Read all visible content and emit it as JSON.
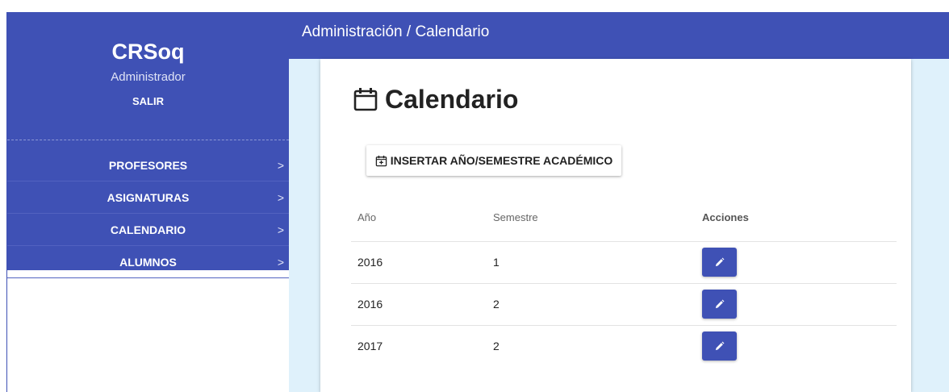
{
  "sidebar": {
    "brand": "CRSoq",
    "role": "Administrador",
    "logout_label": "SALIR",
    "items": [
      {
        "label": "PROFESORES",
        "chevron": ">"
      },
      {
        "label": "ASIGNATURAS",
        "chevron": ">"
      },
      {
        "label": "CALENDARIO",
        "chevron": ">"
      },
      {
        "label": "ALUMNOS",
        "chevron": ">"
      }
    ]
  },
  "header": {
    "breadcrumb": "Administración / Calendario"
  },
  "main": {
    "title": "Calendario",
    "title_icon": "calendar-icon",
    "insert_button_label": "INSERTAR AÑO/SEMESTRE ACADÉMICO",
    "insert_button_icon": "calendar-plus-icon",
    "table": {
      "headers": {
        "year": "Año",
        "semester": "Semestre",
        "actions": "Acciones"
      },
      "rows": [
        {
          "year": "2016",
          "semester": "1"
        },
        {
          "year": "2016",
          "semester": "2"
        },
        {
          "year": "2017",
          "semester": "2"
        }
      ],
      "action_icon": "pencil-icon"
    }
  },
  "colors": {
    "primary": "#3f51b5",
    "background": "#dff1fb",
    "card": "#ffffff"
  }
}
